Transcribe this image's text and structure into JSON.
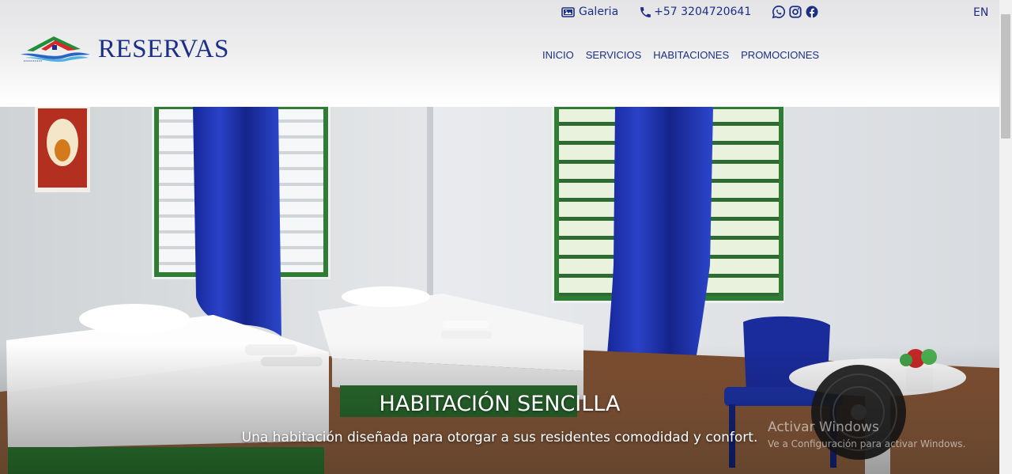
{
  "topbar": {
    "gallery_label": "Galeria",
    "phone": "+57 3204720641",
    "social": [
      "whatsapp-icon",
      "instagram-icon",
      "facebook-icon"
    ],
    "language": "EN"
  },
  "brand": {
    "name": "RESERVAS"
  },
  "nav": {
    "items": [
      {
        "label": "INICIO"
      },
      {
        "label": "SERVICIOS"
      },
      {
        "label": "HABITACIONES"
      },
      {
        "label": "PROMOCIONES"
      }
    ]
  },
  "hero": {
    "title": "HABITACIÓN SENCILLA",
    "subtitle": "Una habitación diseñada para otorgar a sus residentes comodidad y confort."
  },
  "watermark": {
    "title": "Activar Windows",
    "subtitle": "Ve a Configuración para activar Windows."
  },
  "colors": {
    "brand": "#1c2f86",
    "curtain": "#1e32b0",
    "window_frame": "#2e7d32",
    "floor": "#8a5a3b"
  }
}
